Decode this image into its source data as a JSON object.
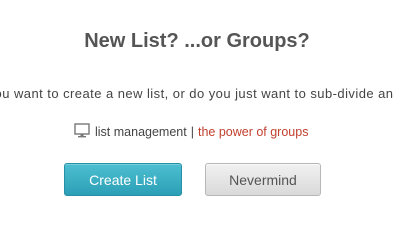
{
  "dialog": {
    "title": "New List? ...or Groups?",
    "description": "Do you want to create a new list, or do you just want to sub-divide an existing list?"
  },
  "links": {
    "icon": "monitor-icon",
    "list_management": "list management",
    "separator": "|",
    "power_of_groups": "the power of groups",
    "power_color": "#c2402e"
  },
  "buttons": {
    "create_label": "Create List",
    "create_color": "#35a9bf",
    "nevermind_label": "Nevermind"
  }
}
